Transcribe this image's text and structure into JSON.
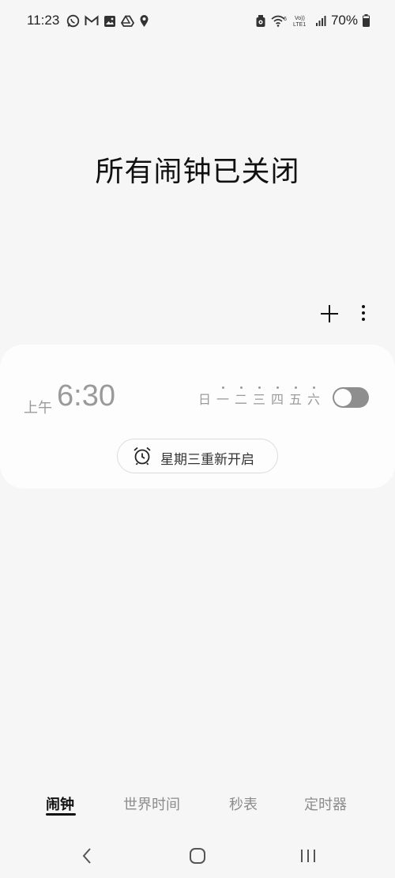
{
  "status_bar": {
    "time": "11:23",
    "left_icons": [
      "whatsapp-icon",
      "gmail-icon",
      "gallery-icon",
      "drive-icon",
      "location-icon"
    ],
    "right_icons": [
      "alarm-status-icon",
      "wifi-icon",
      "volte-icon",
      "signal-icon",
      "battery-icon"
    ],
    "volte_label_top": "Vo))",
    "volte_label_bottom": "LTE1",
    "battery": "70%"
  },
  "main": {
    "headline": "所有闹钟已关闭"
  },
  "actions": {
    "add_icon": "plus-icon",
    "more_icon": "more-vertical-icon"
  },
  "alarm": {
    "ampm": "上午",
    "time": "6:30",
    "days": [
      {
        "label": "日",
        "selected": false
      },
      {
        "label": "一",
        "selected": true
      },
      {
        "label": "二",
        "selected": true
      },
      {
        "label": "三",
        "selected": true
      },
      {
        "label": "四",
        "selected": true
      },
      {
        "label": "五",
        "selected": true
      },
      {
        "label": "六",
        "selected": true
      }
    ],
    "enabled": false,
    "resume_label": "星期三重新开启"
  },
  "tabs": [
    {
      "label": "闹钟",
      "active": true
    },
    {
      "label": "世界时间",
      "active": false
    },
    {
      "label": "秒表",
      "active": false
    },
    {
      "label": "定时器",
      "active": false
    }
  ],
  "colors": {
    "background": "#f6f6f6",
    "card": "#fdfdfd",
    "muted": "#9a9a9a",
    "toggle_off": "#8e8e8e"
  }
}
